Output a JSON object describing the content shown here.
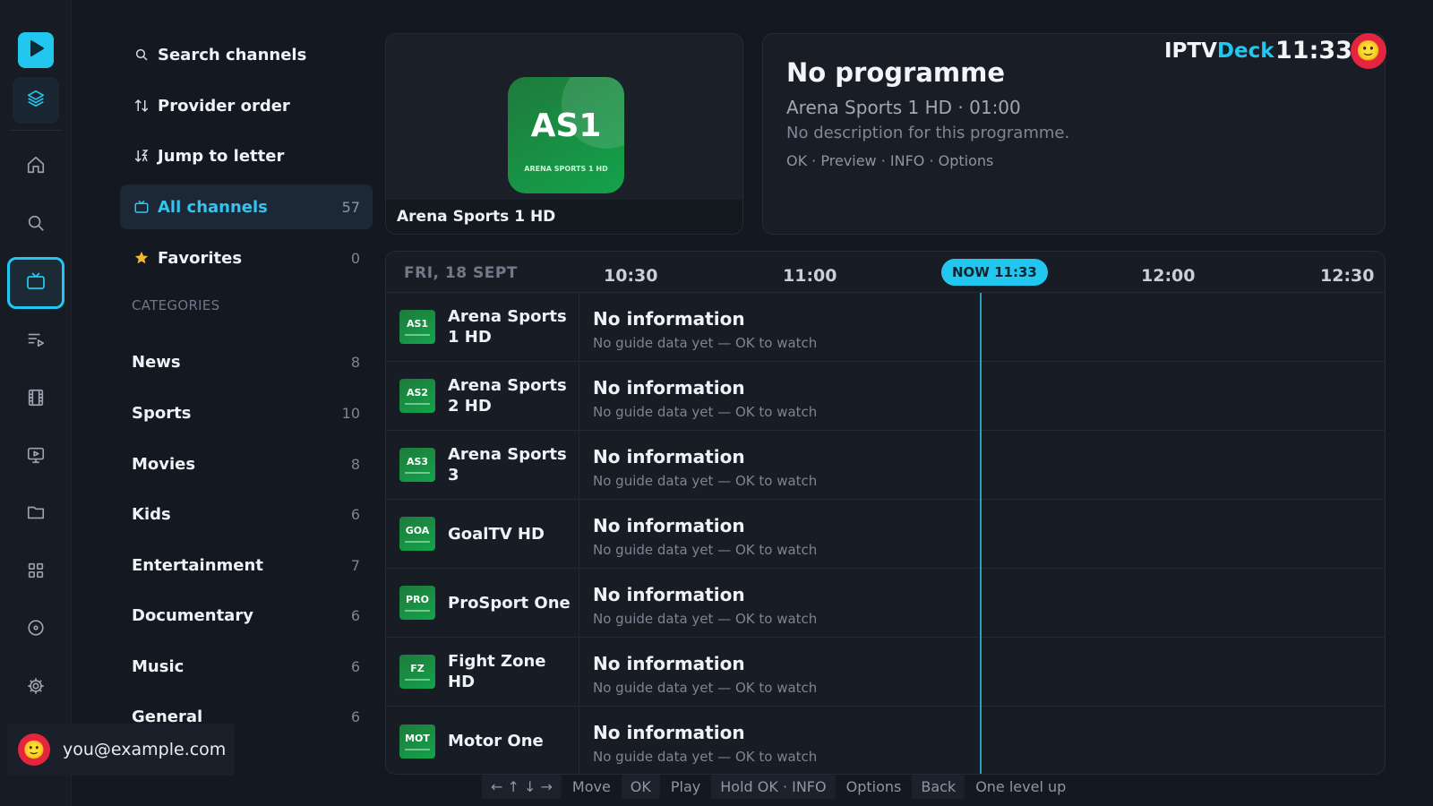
{
  "rail": {
    "logo_icon": "play-icon",
    "items": [
      {
        "icon": "layers-icon"
      },
      {
        "icon": "home-icon"
      },
      {
        "icon": "search-icon"
      },
      {
        "icon": "tv-icon"
      },
      {
        "icon": "playlist-icon"
      },
      {
        "icon": "film-icon"
      },
      {
        "icon": "monitor-play-icon"
      },
      {
        "icon": "folder-icon"
      },
      {
        "icon": "grid-icon"
      },
      {
        "icon": "disc-icon"
      },
      {
        "icon": "settings-icon"
      }
    ]
  },
  "menu": {
    "search": "Search channels",
    "provider_order": "Provider order",
    "jump_to_letter": "Jump to letter",
    "all_channels": {
      "label": "All channels",
      "count": "57"
    },
    "favorites": {
      "label": "Favorites",
      "count": "0"
    },
    "categories_title": "CATEGORIES",
    "categories": [
      {
        "label": "News",
        "count": "8"
      },
      {
        "label": "Sports",
        "count": "10"
      },
      {
        "label": "Movies",
        "count": "8"
      },
      {
        "label": "Kids",
        "count": "6"
      },
      {
        "label": "Entertainment",
        "count": "7"
      },
      {
        "label": "Documentary",
        "count": "6"
      },
      {
        "label": "Music",
        "count": "6"
      },
      {
        "label": "General",
        "count": "6"
      }
    ]
  },
  "user": {
    "email": "you@example.com",
    "avatar": "🙂"
  },
  "header": {
    "brand_main": "IPTV",
    "brand_accent": "Deck",
    "clock": "11:33",
    "avatar": "🙂"
  },
  "preview": {
    "logo_text": "AS1",
    "logo_subtext": "ARENA SPORTS 1 HD",
    "caption": "Arena Sports 1 HD"
  },
  "info": {
    "title": "No programme",
    "subtitle": "Arena Sports 1 HD · 01:00",
    "description": "No description for this programme.",
    "keys": "OK · Preview · INFO · Options"
  },
  "guide": {
    "date": "FRI, 18 SEPT",
    "times": [
      "10:30",
      "11:00",
      "12:00",
      "12:30"
    ],
    "now_label": "NOW 11:33",
    "rows": [
      {
        "logo": "AS1",
        "name": "Arena Sports 1 HD",
        "title": "No information",
        "sub": "No guide data yet — OK to watch"
      },
      {
        "logo": "AS2",
        "name": "Arena Sports 2 HD",
        "title": "No information",
        "sub": "No guide data yet — OK to watch"
      },
      {
        "logo": "AS3",
        "name": "Arena Sports 3",
        "title": "No information",
        "sub": "No guide data yet — OK to watch"
      },
      {
        "logo": "GOA",
        "name": "GoalTV HD",
        "title": "No information",
        "sub": "No guide data yet — OK to watch"
      },
      {
        "logo": "PRO",
        "name": "ProSport One",
        "title": "No information",
        "sub": "No guide data yet — OK to watch"
      },
      {
        "logo": "FZ",
        "name": "Fight Zone HD",
        "title": "No information",
        "sub": "No guide data yet — OK to watch"
      },
      {
        "logo": "MOT",
        "name": "Motor One",
        "title": "No information",
        "sub": "No guide data yet — OK to watch"
      }
    ]
  },
  "hints": [
    {
      "key": "← ↑ ↓ →",
      "label": "Move"
    },
    {
      "key": "OK",
      "label": "Play"
    },
    {
      "key": "Hold OK · INFO",
      "label": "Options"
    },
    {
      "key": "Back",
      "label": "One level up"
    }
  ],
  "colors": {
    "accent": "#22c7f0",
    "background": "#131821",
    "channel_logo": "#13a34a",
    "avatar": "#e3263e"
  }
}
